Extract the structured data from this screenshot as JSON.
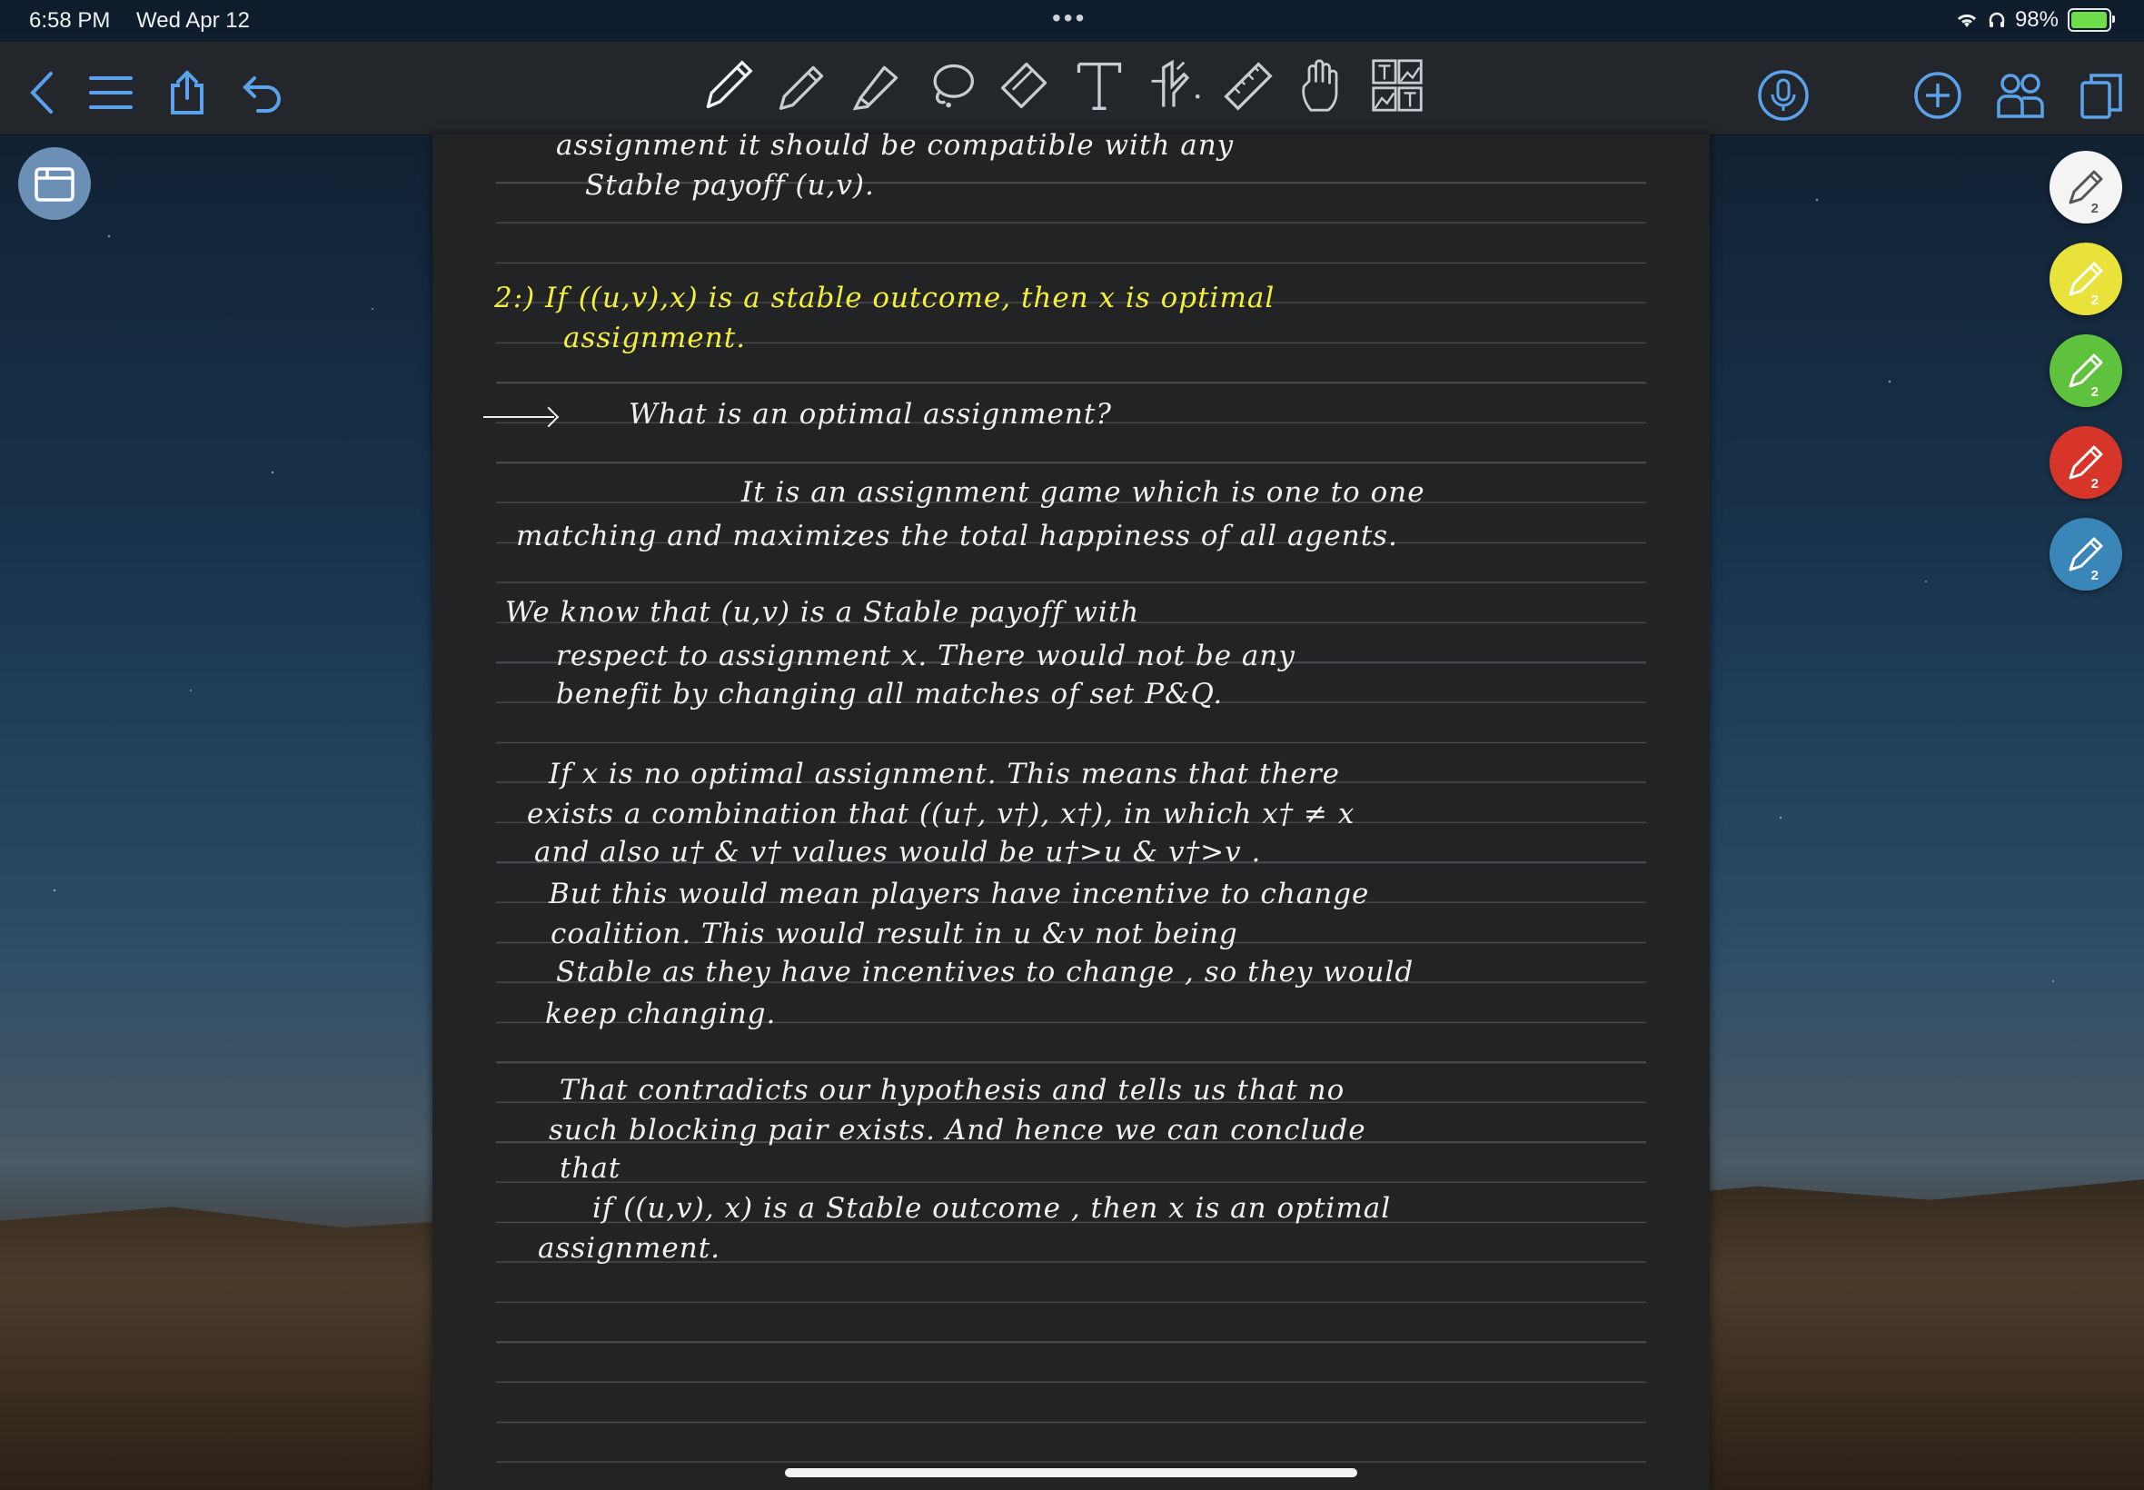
{
  "status_bar": {
    "time": "6:58 PM",
    "date": "Wed Apr 12",
    "more": "•••",
    "battery": "98%"
  },
  "toolbar": {
    "left": [
      {
        "name": "back-icon"
      },
      {
        "name": "menu-icon"
      },
      {
        "name": "share-icon"
      },
      {
        "name": "undo-icon"
      }
    ],
    "tools": [
      {
        "name": "fountain-pen-icon"
      },
      {
        "name": "pencil-icon"
      },
      {
        "name": "highlighter-icon"
      },
      {
        "name": "lasso-icon"
      },
      {
        "name": "eraser-icon"
      },
      {
        "name": "text-icon"
      },
      {
        "name": "shapes-icon"
      },
      {
        "name": "ruler-icon"
      },
      {
        "name": "hand-icon"
      },
      {
        "name": "image-text-icon"
      }
    ],
    "right": [
      {
        "name": "microphone-icon"
      },
      {
        "name": "add-icon"
      },
      {
        "name": "collaborate-icon"
      },
      {
        "name": "pages-icon"
      }
    ]
  },
  "pens": [
    {
      "color": "#f4f4f4",
      "count": "2"
    },
    {
      "color": "#e8e23a",
      "count": "2"
    },
    {
      "color": "#5ec23c",
      "count": "2"
    },
    {
      "color": "#d8352a",
      "count": "2"
    },
    {
      "color": "#3a86b8",
      "count": "2"
    }
  ],
  "notes": {
    "l1": "assignment   it   should   be   compatible   with   any",
    "l2": "Stable   payoff   (u,v).",
    "l3": "2:)    If   ((u,v),x)   is   a  stable  outcome,  then  x is  optimal",
    "l4": "assignment.",
    "l5": "What   is   an   optimal   assignment?",
    "l6": "It is   an   assignment   game  which   is   one to one",
    "l7": "matching   and   maximizes  the  total  happiness  of  all  agents.",
    "l8": "We   know   that    (u,v)    is    a    Stable    payoff    with",
    "l9": "respect   to    assignment  x.   There   would   not   be  any",
    "l10": "benefit   by    changing    all   matches   of   set   P&Q.",
    "l11": "If    x   is   no   optimal   assignment.  This  means  that  there",
    "l12": "exists   a   combination   that  ((u†, v†), x†),  in  which   x† ≠ x",
    "l13": "and   also    u† & v†   values   would   be   u†>u  &  v†>v .",
    "l14": "But   this   would   mean   players   have   incentive   to   change",
    "l15": "coalition.   This   would   result  in   u &v   not   being",
    "l16": "Stable as   they   have   incentives  to  change , so  they  would",
    "l17": "keep   changing.",
    "l18": "That  contradicts   our  hypothesis  and   tells  us   that  no",
    "l19": "such   blocking   pair   exists.  And   hence   we   can   conclude",
    "l20": "that",
    "l21": "if ((u,v), x)  is   a   Stable   outcome ,  then  x  is   an  optimal",
    "l22": "assignment."
  }
}
